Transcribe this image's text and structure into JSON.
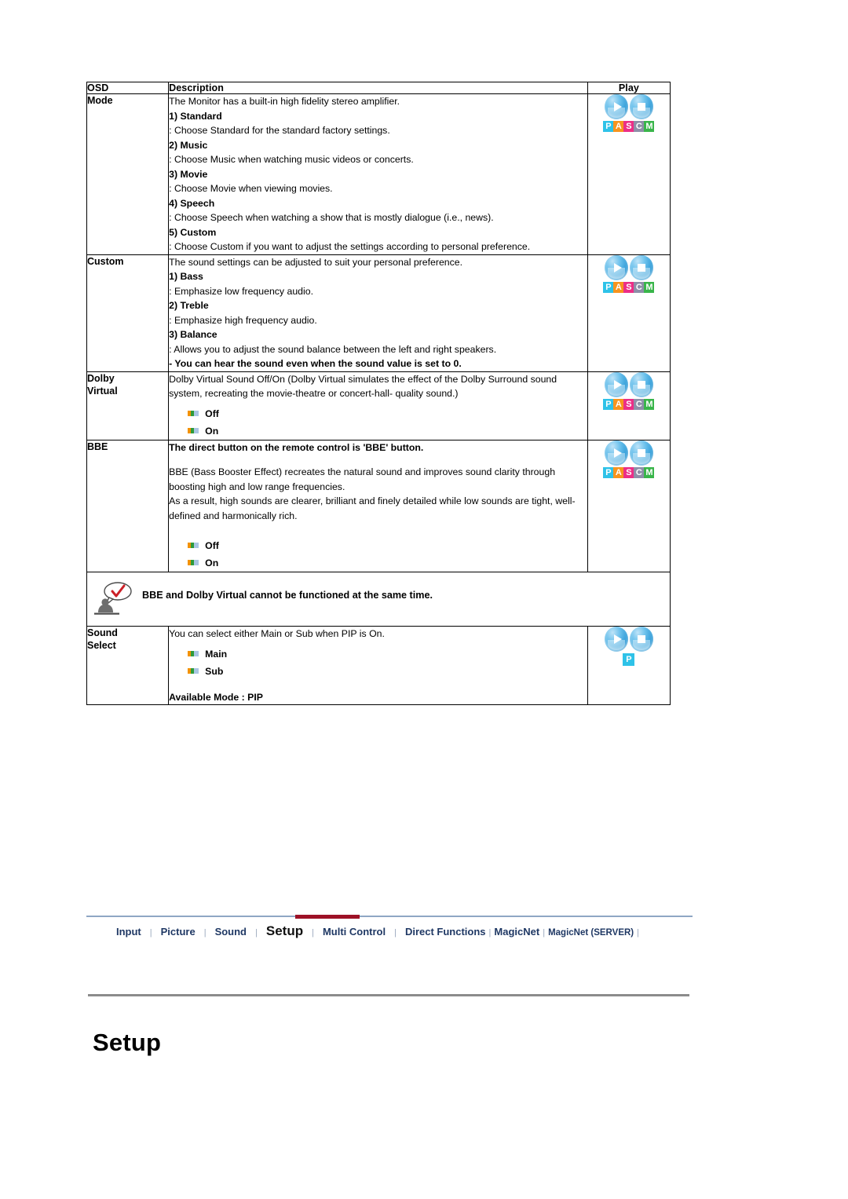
{
  "table": {
    "headers": {
      "osd": "OSD",
      "description": "Description",
      "play": "Play"
    },
    "rows": [
      {
        "osd": "Mode",
        "lead": "The Monitor has a built-in high fidelity stereo amplifier.",
        "items": [
          {
            "head": "1) Standard",
            "body": ": Choose Standard for the standard factory settings."
          },
          {
            "head": "2) Music",
            "body": ": Choose Music when watching music videos or concerts."
          },
          {
            "head": "3) Movie",
            "body": ": Choose Movie when viewing movies."
          },
          {
            "head": "4) Speech",
            "body": ": Choose Speech when watching a show that is mostly dialogue (i.e., news)."
          },
          {
            "head": "5) Custom",
            "body": ": Choose Custom if you want to adjust the settings according to personal preference."
          }
        ],
        "play_icon": "pascm-play-icon"
      },
      {
        "osd": "Custom",
        "lead": "The sound settings can be adjusted to suit your personal preference.",
        "items": [
          {
            "head": "1) Bass",
            "body": ": Emphasize low frequency audio."
          },
          {
            "head": "2) Treble",
            "body": ": Emphasize high frequency audio."
          },
          {
            "head": "3) Balance",
            "body": ": Allows you to adjust the sound balance between the left and right speakers."
          }
        ],
        "bold_note": "- You can hear the sound even when the sound value is set to 0.",
        "play_icon": "pascm-play-icon"
      },
      {
        "osd": "Dolby Virtual",
        "osd_line1": "Dolby",
        "osd_line2": "Virtual",
        "lead": "Dolby Virtual Sound Off/On (Dolby Virtual simulates the effect of the Dolby Surround sound system, recreating the movie-theatre or concert-hall- quality sound.)",
        "options": [
          "Off",
          "On"
        ],
        "play_icon": "pascm-play-icon"
      },
      {
        "osd": "BBE",
        "bold_lead": "The direct button on the remote control is 'BBE' button.",
        "body1": "BBE (Bass Booster Effect) recreates the natural sound and improves sound clarity through boosting high and low range frequencies.",
        "body2": "As a result, high sounds are clearer, brilliant and finely detailed while low sounds are tight, well-defined and harmonically rich.",
        "options": [
          "Off",
          "On"
        ],
        "play_icon": "pascm-play-icon"
      }
    ],
    "note_row": {
      "icon": "tip-person-icon",
      "text": "BBE and Dolby Virtual cannot be functioned at the same time."
    },
    "sound_select_row": {
      "osd_line1": "Sound",
      "osd_line2": "Select",
      "lead": "You can select either Main or Sub when PIP is On.",
      "options": [
        "Main",
        "Sub"
      ],
      "available_mode": "Available Mode : PIP",
      "play_icon": "p-play-icon"
    }
  },
  "nav": {
    "items": [
      {
        "label": "Input",
        "active": false,
        "small": false
      },
      {
        "label": "Picture",
        "active": false,
        "small": false
      },
      {
        "label": "Sound",
        "active": false,
        "small": false
      },
      {
        "label": "Setup",
        "active": true,
        "small": false
      },
      {
        "label": "Multi Control",
        "active": false,
        "small": false
      },
      {
        "label": "Direct Functions",
        "active": false,
        "small": false
      },
      {
        "label": "MagicNet",
        "active": false,
        "small": false
      },
      {
        "label": "MagicNet (SERVER)",
        "active": false,
        "small": true
      }
    ],
    "separator": "|",
    "active_color": "#9d1126",
    "link_color": "#1F3864"
  },
  "heading": {
    "title": "Setup"
  },
  "pascm_letters": [
    {
      "char": "P",
      "color": "#2EC2E8"
    },
    {
      "char": "A",
      "color": "#F7941E"
    },
    {
      "char": "S",
      "color": "#EC2E87"
    },
    {
      "char": "C",
      "color": "#8E8FA8"
    },
    {
      "char": "M",
      "color": "#39B54A"
    }
  ],
  "p_letter": [
    {
      "char": "P",
      "color": "#2EC2E8"
    }
  ]
}
